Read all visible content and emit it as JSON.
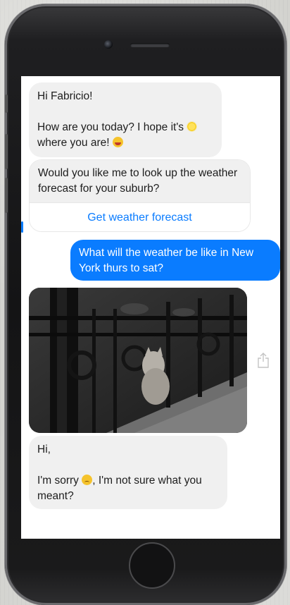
{
  "messages": {
    "greeting_line1": "Hi Fabricio!",
    "greeting_line2a": "How are you today? I hope it's",
    "greeting_line2b": "where you are!",
    "prompt_text": "Would you like me to look up the weather forecast for your suburb?",
    "action_label": "Get weather forecast",
    "user_message": "What will the weather be like in New York thurs to sat?",
    "reply_line1": "Hi,",
    "reply_line2a": "I'm sorry",
    "reply_line2b": ", I'm not sure what you meant?"
  },
  "icons": {
    "sun_emoji": "sun-emoji",
    "grin_emoji": "grin-emoji",
    "sad_emoji": "sad-emoji",
    "share": "share-icon"
  },
  "colors": {
    "accent": "#0a7cff",
    "incoming_bubble": "#f0f0f0",
    "outgoing_text": "#ffffff"
  }
}
